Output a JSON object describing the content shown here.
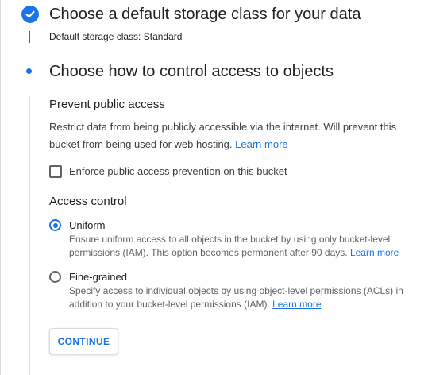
{
  "step1": {
    "title": "Choose a default storage class for your data",
    "summary_label": "Default storage class:",
    "summary_value": "Standard"
  },
  "step2": {
    "title": "Choose how to control access to objects",
    "prevent_public_access": {
      "heading": "Prevent public access",
      "description": "Restrict data from being publicly accessible via the internet. Will prevent this bucket from being used for web hosting.",
      "learn_more": "Learn more",
      "checkbox_label": "Enforce public access prevention on this bucket",
      "checkbox_checked": false
    },
    "access_control": {
      "heading": "Access control",
      "options": [
        {
          "label": "Uniform",
          "description": "Ensure uniform access to all objects in the bucket by using only bucket-level permissions (IAM). This option becomes permanent after 90 days.",
          "learn_more": "Learn more",
          "selected": true
        },
        {
          "label": "Fine-grained",
          "description": "Specify access to individual objects by using object-level permissions (ACLs) in addition to your bucket-level permissions (IAM).",
          "learn_more": "Learn more",
          "selected": false
        }
      ]
    },
    "continue_label": "CONTINUE"
  },
  "colors": {
    "accent": "#1a73e8",
    "text_primary": "#202124",
    "text_secondary": "#5f6368",
    "divider": "#dadce0"
  },
  "icons": {
    "step1_status": "check-circle-icon",
    "step2_status": "current-step-dot-icon"
  }
}
